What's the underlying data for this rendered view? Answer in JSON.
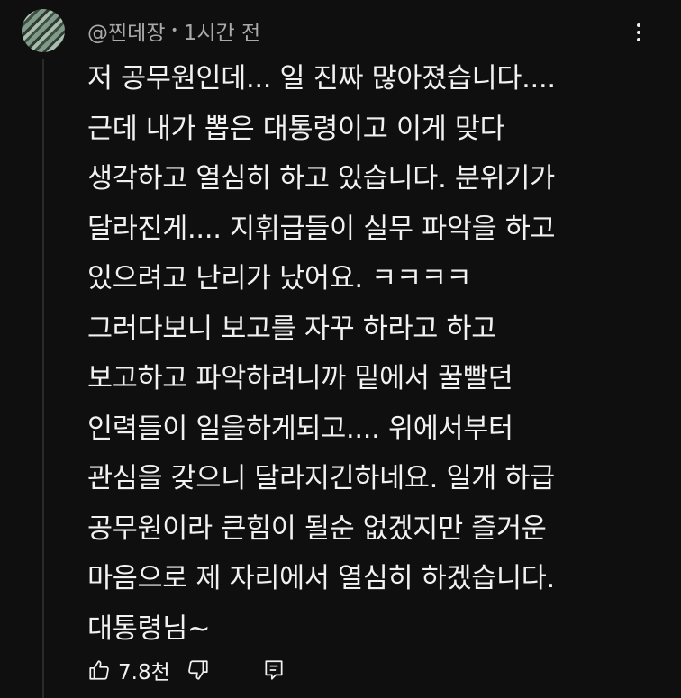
{
  "comment": {
    "author": "@찐데장",
    "separator": "•",
    "time": "1시간 전",
    "lines": [
      "저 공무원인데... 일 진짜 많아졌습니다....",
      "근데 내가 뽑은 대통령이고 이게 맞다",
      "생각하고 열심히 하고 있습니다. 분위기가",
      "달라진게.... 지휘급들이 실무 파악을 하고",
      "있으려고 난리가 났어요. ㅋㅋㅋㅋ",
      "그러다보니 보고를 자꾸 하라고 하고",
      "보고하고 파악하려니까 밑에서 꿀빨던",
      "인력들이 일을하게되고.... 위에서부터",
      "관심을 갖으니 달라지긴하네요. 일개 하급",
      "공무원이라 큰힘이 될순 없겠지만 즐거운",
      "마음으로 제 자리에서 열심히 하겠습니다.",
      "대통령님~"
    ],
    "like_count": "7.8천"
  },
  "icons": {
    "avatar": "avatar-image",
    "more": "more-vert-icon",
    "like": "thumb-up-icon",
    "dislike": "thumb-down-icon",
    "reply": "reply-comment-icon"
  },
  "colors": {
    "background": "#0f0f0f",
    "text": "#f1f1f1",
    "secondary_text": "#aaaaaa"
  }
}
